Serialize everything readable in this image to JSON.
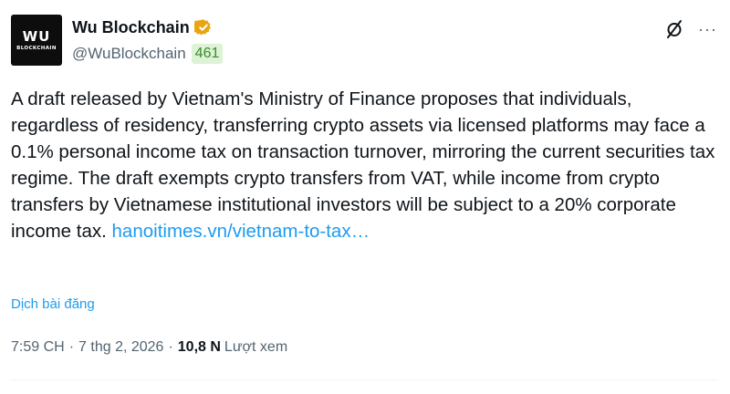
{
  "author": {
    "avatar_text_main": "WU",
    "avatar_text_sub": "BLOCKCHAIN",
    "display_name": "Wu Blockchain",
    "handle": "@WuBlockchain",
    "follower_badge": "461",
    "verified_icon": "verified-badge-gold",
    "verified_color": "#e8a50f"
  },
  "actions": {
    "grok_icon": "grok-slash-icon",
    "more_label": "···"
  },
  "post": {
    "text": "A draft released by Vietnam's Ministry of Finance proposes that individuals, regardless of residency, transferring crypto assets via licensed platforms may face a 0.1% personal income tax on transaction turnover, mirroring the current securities tax regime. The draft exempts crypto transfers from VAT, while income from crypto transfers by Vietnamese institutional investors will be subject to a 20% corporate income tax. ",
    "link_text": "hanoitimes.vn/vietnam-to-tax…",
    "translate_label": "Dịch bài đăng"
  },
  "meta": {
    "time": "7:59 CH",
    "separator": "·",
    "date": "7 thg 2, 2026",
    "views_count": "10,8 N",
    "views_label": "Lượt xem"
  },
  "colors": {
    "link": "#1d9bf0",
    "muted": "#536471",
    "text": "#0f1419",
    "badge_bg": "#dcf3d5",
    "badge_text": "#3a8a28"
  }
}
